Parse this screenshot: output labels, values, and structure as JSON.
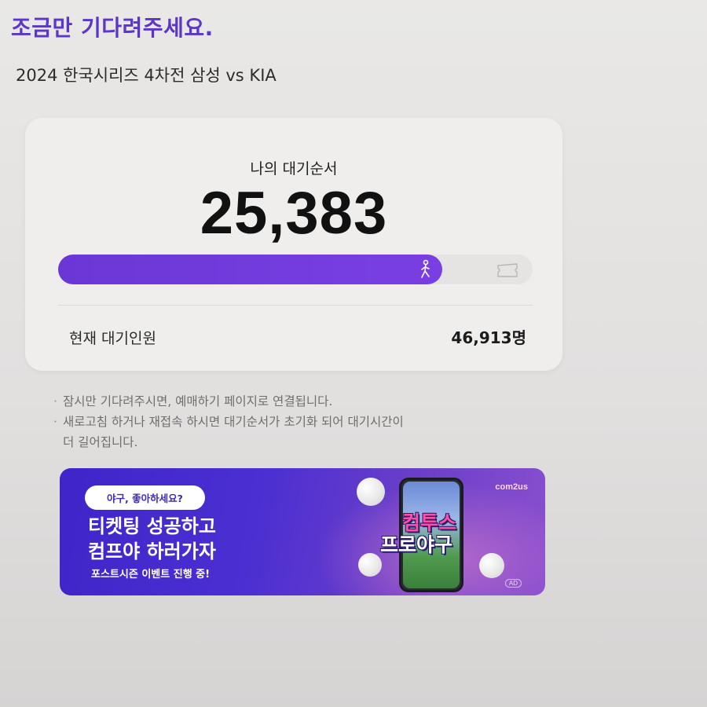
{
  "header": {
    "title": "조금만 기다려주세요.",
    "subtitle": "2024 한국시리즈 4차전 삼성 vs KIA"
  },
  "queue": {
    "label": "나의 대기순서",
    "position": "25,383",
    "progress_fraction": 0.81,
    "waiting_label": "현재 대기인원",
    "waiting_count": "46,913명"
  },
  "notices": [
    "잠시만 기다려주시면, 예매하기 페이지로 연결됩니다.",
    "새로고침 하거나 재접속 하시면 대기순서가 초기화 되어 대기시간이",
    "더 길어집니다."
  ],
  "banner": {
    "pill_text": "야구, 좋아하세요?",
    "headline_line1": "티켓팅 성공하고",
    "headline_line2": "컴프야 하러가자",
    "sub_text": "포스트시즌 이벤트 진행 중!",
    "brand": "com2us",
    "game_title_line1": "컴투스",
    "game_title_line2": "프로야구",
    "ad_label": "AD"
  },
  "colors": {
    "accent": "#5b36c9",
    "progress": "#6a37d6"
  },
  "icons": {
    "runner": "runner-icon",
    "ticket": "ticket-icon"
  }
}
